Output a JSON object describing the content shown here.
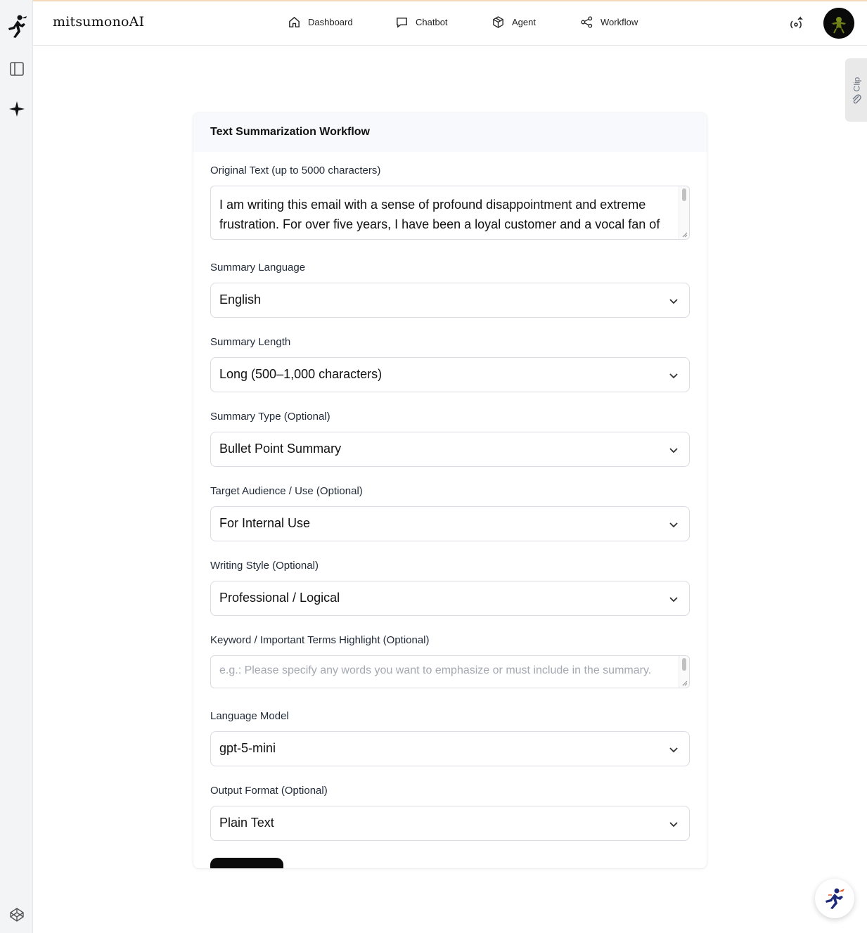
{
  "app": {
    "brand": "mitsumonoAI"
  },
  "nav": [
    {
      "label": "Dashboard",
      "icon": "home-icon"
    },
    {
      "label": "Chatbot",
      "icon": "chat-icon"
    },
    {
      "label": "Agent",
      "icon": "cube-icon"
    },
    {
      "label": "Workflow",
      "icon": "share-nodes-icon"
    }
  ],
  "clip_tab": {
    "label": "Clip"
  },
  "form": {
    "title": "Text Summarization Workflow",
    "original_text": {
      "label": "Original Text (up to 5000 characters)",
      "value": "I am writing this email with a sense of profound disappointment and extreme frustration. For over five years, I have been a loyal customer and a vocal fan of"
    },
    "summary_language": {
      "label": "Summary Language",
      "value": "English"
    },
    "summary_length": {
      "label": "Summary Length",
      "value": "Long (500–1,000 characters)"
    },
    "summary_type": {
      "label": "Summary Type (Optional)",
      "value": "Bullet Point Summary"
    },
    "target_audience": {
      "label": "Target Audience / Use (Optional)",
      "value": "For Internal Use"
    },
    "writing_style": {
      "label": "Writing Style (Optional)",
      "value": "Professional / Logical"
    },
    "keywords": {
      "label": "Keyword / Important Terms Highlight (Optional)",
      "placeholder": "e.g.: Please specify any words you want to emphasize or must include in the summary."
    },
    "language_model": {
      "label": "Language Model",
      "value": "gpt-5-mini"
    },
    "output_format": {
      "label": "Output Format (Optional)",
      "value": "Plain Text"
    }
  },
  "colors": {
    "accent": "#0b0b0b",
    "sidebar_bg": "#f3f4f6",
    "card_head_bg": "#f7f9fc",
    "border": "#d9dce1"
  }
}
